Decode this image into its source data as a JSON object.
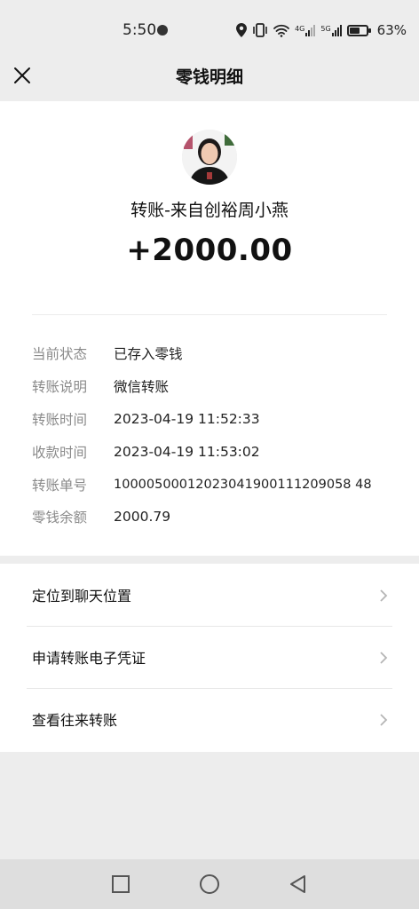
{
  "status_bar": {
    "time": "5:50",
    "signal_4g": "4G",
    "signal_5g": "5G",
    "battery": "63%",
    "battery_level": 0.63
  },
  "header": {
    "title": "零钱明细"
  },
  "transfer": {
    "sender": "转账-来自创裕周小燕",
    "amount": "+2000.00"
  },
  "details": [
    {
      "label": "当前状态",
      "value": "已存入零钱"
    },
    {
      "label": "转账说明",
      "value": "微信转账"
    },
    {
      "label": "转账时间",
      "value": "2023-04-19 11:52:33"
    },
    {
      "label": "收款时间",
      "value": "2023-04-19 11:53:02"
    },
    {
      "label": "转账单号",
      "value": "10000500012023041900111209058 48"
    },
    {
      "label": "零钱余额",
      "value": "2000.79"
    }
  ],
  "menu": [
    {
      "label": "定位到聊天位置"
    },
    {
      "label": "申请转账电子凭证"
    },
    {
      "label": "查看往来转账"
    }
  ]
}
